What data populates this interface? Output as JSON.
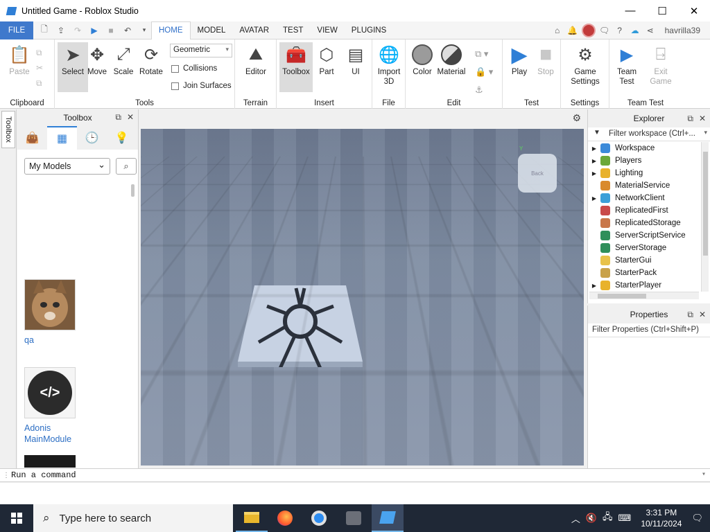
{
  "window": {
    "title": "Untitled Game - Roblox Studio",
    "minimize": "—",
    "maximize": "☐",
    "close": "✕"
  },
  "menubar": {
    "file": "FILE",
    "tabs": [
      "HOME",
      "MODEL",
      "AVATAR",
      "TEST",
      "VIEW",
      "PLUGINS"
    ],
    "active_tab": "HOME",
    "username": "havrilla39"
  },
  "ribbon": {
    "clipboard": {
      "label": "Clipboard",
      "paste": "Paste"
    },
    "tools": {
      "label": "Tools",
      "select": "Select",
      "move": "Move",
      "scale": "Scale",
      "rotate": "Rotate",
      "mode": "Geometric",
      "collisions": "Collisions",
      "join_surfaces": "Join Surfaces"
    },
    "terrain": {
      "label": "Terrain",
      "editor": "Editor"
    },
    "insert": {
      "label": "Insert",
      "toolbox": "Toolbox",
      "part": "Part",
      "ui": "UI"
    },
    "file": {
      "label": "File",
      "import3d_line1": "Import",
      "import3d_line2": "3D"
    },
    "edit": {
      "label": "Edit",
      "color": "Color",
      "material": "Material"
    },
    "test": {
      "label": "Test",
      "play": "Play",
      "stop": "Stop"
    },
    "settings": {
      "label": "Settings",
      "game_settings_line1": "Game",
      "game_settings_line2": "Settings"
    },
    "team_test": {
      "label": "Team Test",
      "team_test_line1": "Team",
      "team_test_line2": "Test",
      "exit_game_line1": "Exit",
      "exit_game_line2": "Game"
    }
  },
  "toolbox": {
    "rail_tab": "Toolbox",
    "title": "Toolbox",
    "category": "My Models",
    "models": [
      {
        "name": "qa"
      },
      {
        "name_line1": "Adonis",
        "name_line2": "MainModule",
        "icon_text": "</>"
      }
    ]
  },
  "viewport": {
    "cube_face": "Back",
    "axis_y": "Y"
  },
  "explorer": {
    "title": "Explorer",
    "filter_placeholder": "Filter workspace (Ctrl+...",
    "items": [
      {
        "label": "Workspace",
        "expandable": true,
        "color": "#3b8ad9"
      },
      {
        "label": "Players",
        "expandable": true,
        "color": "#6ba83a"
      },
      {
        "label": "Lighting",
        "expandable": true,
        "color": "#e8b22c"
      },
      {
        "label": "MaterialService",
        "expandable": false,
        "color": "#d98a2c"
      },
      {
        "label": "NetworkClient",
        "expandable": true,
        "color": "#3c9fd8"
      },
      {
        "label": "ReplicatedFirst",
        "expandable": false,
        "color": "#c94a4a"
      },
      {
        "label": "ReplicatedStorage",
        "expandable": false,
        "color": "#c9774a"
      },
      {
        "label": "ServerScriptService",
        "expandable": false,
        "color": "#2f8f5a"
      },
      {
        "label": "ServerStorage",
        "expandable": false,
        "color": "#2f8f5a"
      },
      {
        "label": "StarterGui",
        "expandable": false,
        "color": "#e8c24a"
      },
      {
        "label": "StarterPack",
        "expandable": false,
        "color": "#c9a24a"
      },
      {
        "label": "StarterPlayer",
        "expandable": true,
        "color": "#e8b22c"
      }
    ]
  },
  "properties": {
    "title": "Properties",
    "filter_placeholder": "Filter Properties (Ctrl+Shift+P)"
  },
  "command_bar": {
    "placeholder": "Run a command"
  },
  "taskbar": {
    "search_placeholder": "Type here to search",
    "time": "3:31 PM",
    "date": "10/11/2024"
  }
}
